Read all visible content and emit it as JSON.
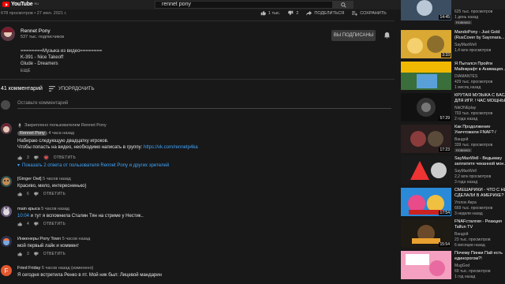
{
  "header": {
    "logo_text": "YouTube",
    "logo_sup": "RU",
    "search_value": "rennet pony"
  },
  "video": {
    "views_line": "678 просмотров • 27 июл. 2021 г.",
    "likes": "1 тыс.",
    "dislikes": "2",
    "share_label": "ПОДЕЛИТЬСЯ",
    "save_label": "СОХРАНИТЬ"
  },
  "channel": {
    "name": "Rennet Pony",
    "subs": "537 тыс. подписчиков",
    "subscribed_label": "ВЫ ПОДПИСАНЫ",
    "desc_lines": [
      "========Музыка из видео========",
      "K-391 - Nice Takeoff",
      "Glude - Dreamers"
    ],
    "more_label": "ЕЩЁ"
  },
  "comments": {
    "count_label": "41 комментарий",
    "sort_label": "УПОРЯДОЧИТЬ",
    "add_placeholder": "Оставьте комментарий",
    "reply_label": "ОТВЕТИТЬ",
    "items": [
      {
        "pinned": "Закреплено пользователем Rennet Pony",
        "author": "Rennet Pony",
        "time": "4 часа назад",
        "line1": "Набираю следующую двадцатку игроков.",
        "line2": "Чтобы попасть на видео, необходимо написать в группу: ",
        "link": "https://vk.com/rennetp4ka",
        "likes": "3",
        "show_replies": "Показать 2 ответа от пользователя Rennet Pony и других зрителей"
      },
      {
        "author": "[Ginger Owl]",
        "time": "5 часов назад",
        "text": "Красиво, мило, интересненько)",
        "likes": "6"
      },
      {
        "author": "main крыса",
        "time": "5 часов назад",
        "timestamp": "10:04",
        "text": " и тут я вспомнила Сталин Тян на стриме у Нестик..",
        "likes": "4"
      },
      {
        "author": "Инженеры Pony Town",
        "time": "5 часов назад",
        "text": "мой первый лайк и коммент",
        "likes": "3"
      },
      {
        "author": "Fried Friday",
        "time": "5 часов назад (изменено)",
        "text": "Я сегодня встретила Ренко в пт. Мой ник был: Лицевой мандарин",
        "avatar_letter": "F"
      }
    ]
  },
  "recommendations": [
    {
      "title": "",
      "sub": "625 тыс. просмотров",
      "sub2": "1 день назад",
      "duration": "14:45",
      "badge": "Новинка"
    },
    {
      "title": "MandoPony - Just Gold",
      "title2": "(RusCover by Sayonara...",
      "sub": "SayMaxWell",
      "sub2": "1,4 млн просмотров",
      "duration": "3:33",
      "badge": ""
    },
    {
      "title": "Я Пытался Пройти",
      "title2": "Майнкрафт в Анимация...",
      "sub": "DIAMANTES",
      "sub2": "429 тыс. просмотров",
      "duration": "",
      "badge": "1 месяц назад"
    },
    {
      "title": "КРУТАЯ МУЗЫКА С БАСА",
      "title2": "ДЛЯ ИГР. ! ЧАС МОЩНЫ...",
      "sub": "NikONEplay",
      "sub2": "703 тыс. просмотров",
      "duration": "57:29",
      "badge": "2 года назад"
    },
    {
      "title": "Как Продолжение",
      "title2": "Уничтожили FNAF? /",
      "sub": "Вандой",
      "sub2": "339 тыс. просмотров",
      "duration": "17:23",
      "badge": "Новинка"
    },
    {
      "title": "SayMaxWell - Ведьмаку",
      "title2": "заплатите чеканной мон...",
      "sub": "SayMaxWell",
      "sub2": "2,2 млн просмотров",
      "duration": "",
      "badge": "3 года назад"
    },
    {
      "title": "СМЕШАРИКИ - ЧТО С НИ",
      "title2": "СДЕЛАЛИ В АМЕРИКЕ? Р...",
      "sub": "Уголок Акра",
      "sub2": "669 тыс. просмотров",
      "duration": "17:54",
      "badge": "3 недели назад"
    },
    {
      "title": "FNAFсталгия - Реакция",
      "title2": "Talfun TV",
      "sub": "Вандой",
      "sub2": "23 тыс. просмотров",
      "duration": "15:54",
      "badge": "6 месяцев назад"
    },
    {
      "title": "Почему Пинки Пай есть",
      "title2": "единорогом?!",
      "sub": "MugGod",
      "sub2": "69 тыс. просмотров",
      "duration": "",
      "badge": "1 год назад"
    }
  ],
  "colors": {
    "accent_link": "#3ea6ff",
    "brand_red": "#ff0000",
    "bg": "#181818"
  }
}
